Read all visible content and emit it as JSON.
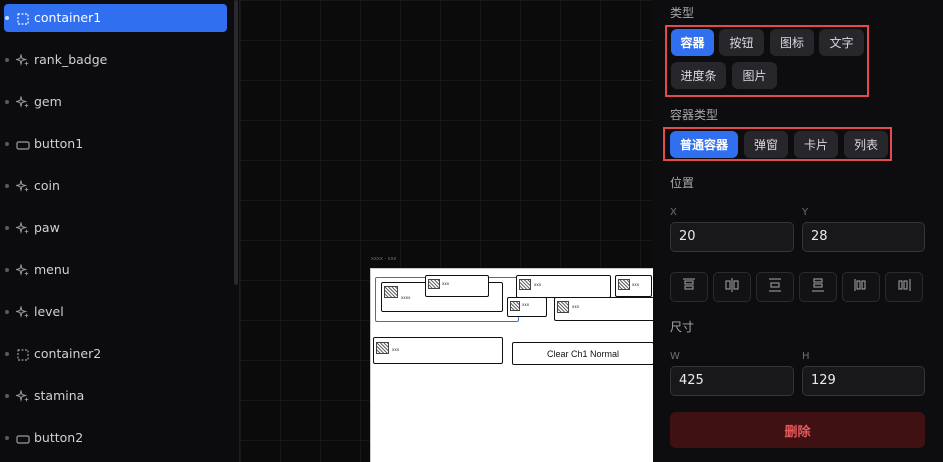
{
  "layers": [
    {
      "name": "container1",
      "icon": "container-icon",
      "selected": true
    },
    {
      "name": "rank_badge",
      "icon": "sparkle-icon"
    },
    {
      "name": "gem",
      "icon": "sparkle-icon"
    },
    {
      "name": "button1",
      "icon": "button-icon"
    },
    {
      "name": "coin",
      "icon": "sparkle-icon"
    },
    {
      "name": "paw",
      "icon": "sparkle-icon"
    },
    {
      "name": "menu",
      "icon": "sparkle-icon"
    },
    {
      "name": "level",
      "icon": "sparkle-icon"
    },
    {
      "name": "container2",
      "icon": "container-icon"
    },
    {
      "name": "stamina",
      "icon": "sparkle-icon"
    },
    {
      "name": "button2",
      "icon": "button-icon"
    }
  ],
  "canvas": {
    "frame_label": "xxxx · xxx",
    "node_texts": [
      "xxxx",
      "xxx",
      "xxx",
      "xxx",
      "xxx",
      "xxx",
      "xxx"
    ],
    "button_text": "Clear Ch1 Normal"
  },
  "inspector": {
    "type_title": "类型",
    "type_options": [
      "容器",
      "按钮",
      "图标",
      "文字",
      "进度条",
      "图片"
    ],
    "type_selected": "容器",
    "container_type_title": "容器类型",
    "container_type_options": [
      "普通容器",
      "弹窗",
      "卡片",
      "列表"
    ],
    "container_type_selected": "普通容器",
    "position_title": "位置",
    "x_label": "X",
    "x_value": "20",
    "y_label": "Y",
    "y_value": "28",
    "size_title": "尺寸",
    "w_label": "W",
    "w_value": "425",
    "h_label": "H",
    "h_value": "129",
    "delete_label": "删除",
    "accent_color": "#2f6ff0",
    "highlight_color": "#e24b4b"
  }
}
